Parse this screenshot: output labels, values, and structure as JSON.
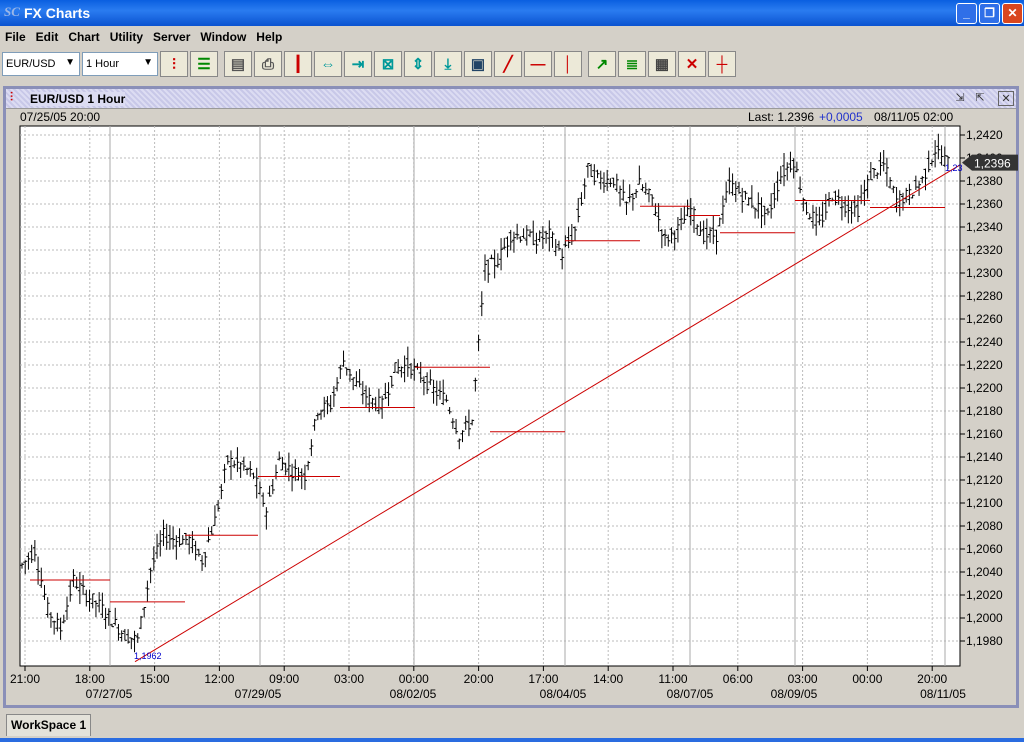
{
  "window": {
    "logo": "SC",
    "title": "FX Charts"
  },
  "menu": [
    "File",
    "Edit",
    "Chart",
    "Utility",
    "Server",
    "Window",
    "Help"
  ],
  "toolbar": {
    "symbol": "EUR/USD",
    "period": "1 Hour",
    "icons": [
      "bar-chart-icon",
      "list-icon",
      "server-icon",
      "print-icon",
      "candle-icon",
      "expand-horizontal-icon",
      "compress-horizontal-icon",
      "fit-icon",
      "expand-vertical-icon",
      "compress-vertical-icon",
      "zoom-box-icon",
      "trendline-icon",
      "horizontal-line-icon",
      "vertical-line-icon",
      "indicator-icon",
      "fibonacci-icon",
      "grid-icon",
      "delete-icon",
      "crosshair-icon"
    ]
  },
  "chart_window": {
    "title": "EUR/USD 1 Hour",
    "start": "07/25/05 20:00",
    "last_label": "Last: 1.2396",
    "change": "+0,0005",
    "end": "08/11/05 02:00",
    "last_badge": "1,2396",
    "trend_start_label": "1,1962",
    "trend_end_label": "1,23"
  },
  "chart_data": {
    "type": "ohlc",
    "ylim": [
      1.1958,
      1.2428
    ],
    "grid": true,
    "y_ticks": [
      "1,1980",
      "1,2000",
      "1,2020",
      "1,2040",
      "1,2060",
      "1,2080",
      "1,2100",
      "1,2120",
      "1,2140",
      "1,2160",
      "1,2180",
      "1,2200",
      "1,2220",
      "1,2240",
      "1,2260",
      "1,2280",
      "1,2300",
      "1,2320",
      "1,2340",
      "1,2360",
      "1,2380",
      "1,2400",
      "1,2420"
    ],
    "y_tick_values": [
      1.198,
      1.2,
      1.202,
      1.204,
      1.206,
      1.208,
      1.21,
      1.212,
      1.214,
      1.216,
      1.218,
      1.22,
      1.222,
      1.224,
      1.226,
      1.228,
      1.23,
      1.232,
      1.234,
      1.236,
      1.238,
      1.24,
      1.242
    ],
    "x_ticks": [
      "21:00",
      "18:00",
      "15:00",
      "12:00",
      "09:00",
      "03:00",
      "00:00",
      "20:00",
      "17:00",
      "14:00",
      "11:00",
      "06:00",
      "03:00",
      "00:00",
      "20:00"
    ],
    "x_dates": [
      "07/27/05",
      "07/29/05",
      "08/02/05",
      "08/04/05",
      "08/07/05",
      "08/09/05",
      "08/11/05"
    ],
    "close_approx": [
      1.2046,
      1.2059,
      1.2007,
      1.199,
      1.2033,
      1.202,
      1.2011,
      1.1998,
      1.1985,
      1.1981,
      1.2042,
      1.2072,
      1.2068,
      1.2068,
      1.205,
      1.2085,
      1.2137,
      1.2133,
      1.2124,
      1.2094,
      1.2137,
      1.2128,
      1.2124,
      1.2181,
      1.2185,
      1.2224,
      1.2203,
      1.219,
      1.2185,
      1.2216,
      1.222,
      1.2211,
      1.2198,
      1.219,
      1.2159,
      1.2172,
      1.2303,
      1.2311,
      1.2333,
      1.2333,
      1.2329,
      1.2333,
      1.2316,
      1.2337,
      1.239,
      1.2381,
      1.2381,
      1.2359,
      1.2377,
      1.2364,
      1.2329,
      1.2338,
      1.2355,
      1.2333,
      1.2333,
      1.2377,
      1.2368,
      1.2359,
      1.235,
      1.2385,
      1.2398,
      1.2355,
      1.2342,
      1.2368,
      1.2359,
      1.2355,
      1.2385,
      1.2394,
      1.2363,
      1.2368,
      1.2381,
      1.2407,
      1.2396
    ],
    "pivot_levels": [
      1.2033,
      1.2014,
      1.2072,
      1.2123,
      1.2183,
      1.2218,
      1.2162,
      1.2328,
      1.2358,
      1.235,
      1.2335,
      1.2363,
      1.2357
    ],
    "trendline": {
      "from": 1.1962,
      "to": 1.2394
    },
    "colors": {
      "bars": "#000000",
      "lines": "#cc0000",
      "labels": "#0000cc"
    }
  },
  "workspace_tab": "WorkSpace 1"
}
